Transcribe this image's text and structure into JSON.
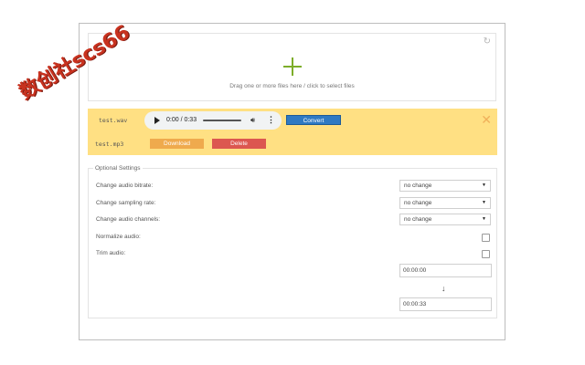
{
  "dropzone": {
    "refresh_icon": "refresh-icon",
    "add_icon": "plus-icon",
    "instruction": "Drag one or more files here / click to select files"
  },
  "files": {
    "input_name": "test.wav",
    "output_name": "test.mp3",
    "player": {
      "time": "0:00 / 0:33"
    },
    "convert_label": "Convert",
    "download_label": "Download",
    "delete_label": "Delete",
    "close_icon": "close-icon"
  },
  "settings": {
    "legend": "Optional Settings",
    "bitrate": {
      "label": "Change audio bitrate:",
      "value": "no change"
    },
    "sampling": {
      "label": "Change sampling rate:",
      "value": "no change"
    },
    "channels": {
      "label": "Change audio channels:",
      "value": "no change"
    },
    "normalize": {
      "label": "Normalize audio:",
      "checked": false
    },
    "trim": {
      "label": "Trim audio:",
      "checked": false
    },
    "trim_start": "00:00:00",
    "trim_arrow": "↓",
    "trim_end": "00:00:33"
  },
  "watermark": "数创社scs66",
  "colors": {
    "accent_green": "#7dad2a",
    "panel_yellow": "#ffe083",
    "convert_blue": "#2f79c3",
    "download_orange": "#efaa4d",
    "delete_red": "#dc5750"
  }
}
